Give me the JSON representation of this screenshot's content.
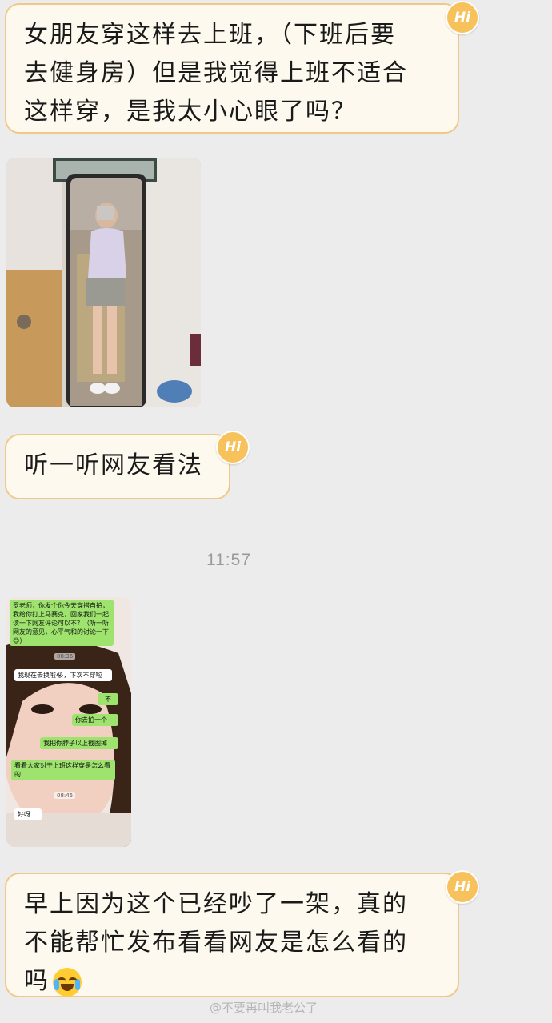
{
  "messages": {
    "m1": "女朋友穿这样去上班，（下班后要\n去健身房）但是我觉得上班不适合\n这样穿，是我太小心眼了吗？",
    "m2": "听一听网友看法",
    "m3_line1": "早上因为这个已经吵了一架，真的",
    "m3_line2": "不能帮忙发布看看网友是怎么看的",
    "m3_line3": "吗"
  },
  "badge_label": "Hi",
  "timestamp": "11:57",
  "screenshot_chat": {
    "msg1": "罗老师，你发个你今天穿搭自拍，我给你打上马赛克，回家我们一起读一下网友评论可以不？（听一听网友的意见，心平气和的讨论一下😊）",
    "time1": "08:36",
    "msg2": "我现在去换啦😭，下次不穿啦",
    "msg3": "不",
    "msg4": "你去拍一个",
    "msg5": "我把你脖子以上截图掉",
    "msg6": "看看大家对于上班这样穿是怎么看的",
    "time2": "08:45",
    "msg7": "好呀"
  },
  "emoji": "crying-laughing-face",
  "watermark": "@不要再叫我老公了",
  "colors": {
    "background": "#ececec",
    "bubble_fill": "#fdf9ee",
    "bubble_border": "#f0c98a",
    "badge": "#f7c25c"
  }
}
